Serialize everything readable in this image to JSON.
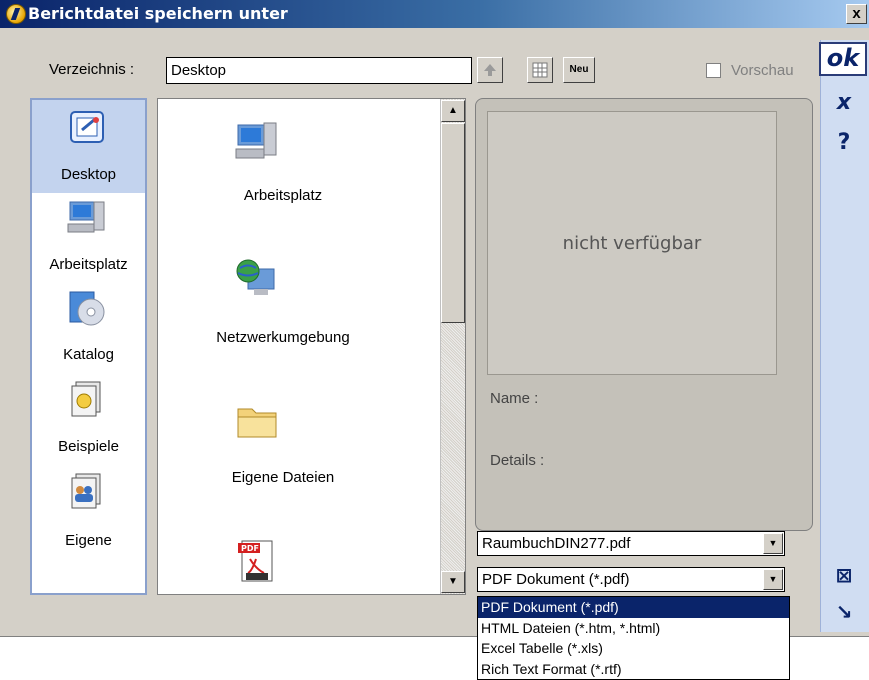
{
  "window": {
    "title": "Berichtdatei speichern unter",
    "close_label": "x"
  },
  "actions": {
    "ok_label": "ok",
    "cancel_label": "x",
    "help_label": "?",
    "boxx_label": "⊠",
    "corner_label": "↘"
  },
  "toolbar": {
    "dir_label": "Verzeichnis :",
    "dir_value": "Desktop",
    "up_icon": "up-arrow-icon",
    "grid_icon": "grid-view-icon",
    "new_label": "Neu",
    "preview_label": "Vorschau",
    "preview_checked": false
  },
  "places": [
    {
      "label": "Desktop",
      "icon": "desktop-icon",
      "selected": true
    },
    {
      "label": "Arbeitsplatz",
      "icon": "computer-icon",
      "selected": false
    },
    {
      "label": "Katalog",
      "icon": "catalog-cd-icon",
      "selected": false
    },
    {
      "label": "Beispiele",
      "icon": "examples-icon",
      "selected": false
    },
    {
      "label": "Eigene",
      "icon": "user-files-icon",
      "selected": false
    }
  ],
  "files": [
    {
      "label": "Arbeitsplatz",
      "icon": "computer-icon"
    },
    {
      "label": "Netzwerkumgebung",
      "icon": "network-globe-icon"
    },
    {
      "label": "Eigene Dateien",
      "icon": "folder-icon"
    },
    {
      "label": "",
      "icon": "pdf-file-icon"
    }
  ],
  "preview": {
    "placeholder": "nicht verfügbar",
    "name_label": "Name :",
    "details_label": "Details :"
  },
  "filename": "RaumbuchDIN277.pdf",
  "filetype": "PDF Dokument (*.pdf)",
  "filetype_options": [
    "PDF Dokument (*.pdf)",
    "HTML Dateien (*.htm, *.html)",
    "Excel Tabelle (*.xls)",
    "Rich Text Format (*.rtf)"
  ],
  "filetype_selected_index": 0
}
